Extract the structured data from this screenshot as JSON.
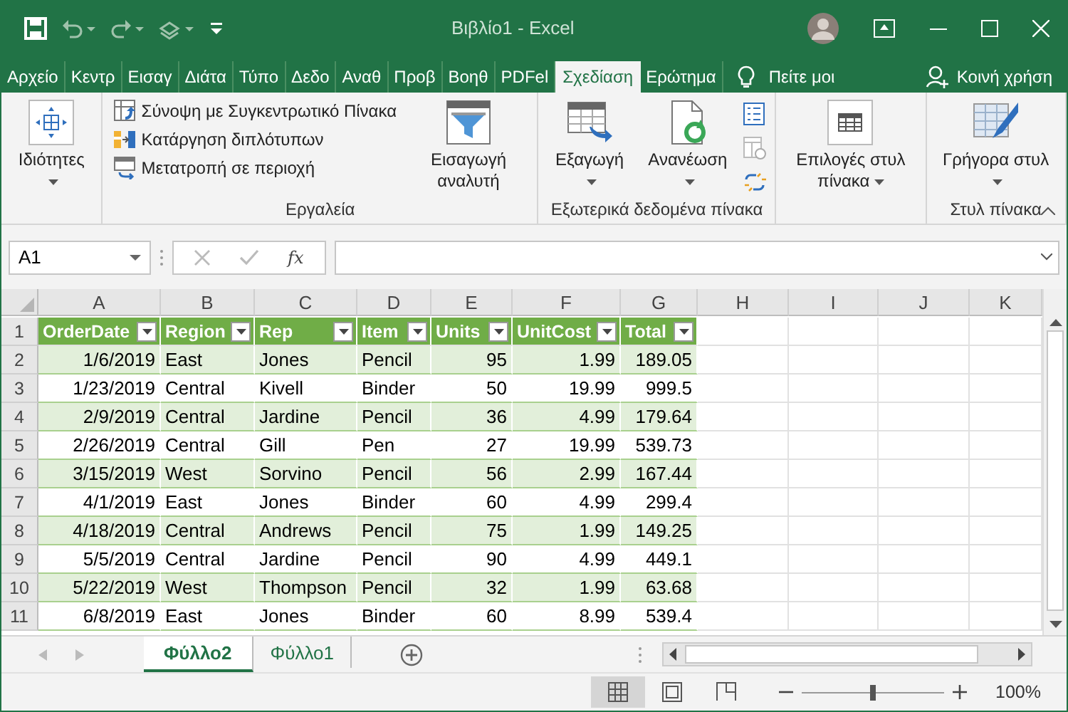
{
  "window": {
    "title": "Βιβλίο1 - Excel"
  },
  "ribbon_tabs": [
    {
      "label": "Αρχείο",
      "selected": false
    },
    {
      "label": "Κεντρ",
      "selected": false
    },
    {
      "label": "Εισαγ",
      "selected": false
    },
    {
      "label": "Διάτα",
      "selected": false
    },
    {
      "label": "Τύπο",
      "selected": false
    },
    {
      "label": "Δεδο",
      "selected": false
    },
    {
      "label": "Αναθ",
      "selected": false
    },
    {
      "label": "Προβ",
      "selected": false
    },
    {
      "label": "Βοηθ",
      "selected": false
    },
    {
      "label": "PDFel",
      "selected": false
    },
    {
      "label": "Σχεδίαση",
      "selected": true
    },
    {
      "label": "Ερώτημα",
      "selected": false
    }
  ],
  "tell_me": "Πείτε μοι",
  "share": "Κοινή χρήση",
  "ribbon_groups": [
    {
      "items": [
        {
          "kind": "large",
          "label": "Ιδιότητες",
          "dropdown": true
        }
      ]
    },
    {
      "label": "Εργαλεία",
      "items": [
        {
          "kind": "stack",
          "buttons": [
            {
              "label": "Σύνοψη με Συγκεντρωτικό Πίνακα"
            },
            {
              "label": "Κατάργηση διπλότυπων"
            },
            {
              "label": "Μετατροπή σε περιοχή"
            }
          ]
        },
        {
          "kind": "large",
          "label": "Εισαγωγή αναλυτή",
          "dropdown": false
        }
      ]
    },
    {
      "label": "Εξωτερικά δεδομένα πίνακα",
      "items": [
        {
          "kind": "large",
          "label": "Εξαγωγή",
          "dropdown": true
        },
        {
          "kind": "large",
          "label": "Ανανέωση",
          "dropdown": true
        },
        {
          "kind": "icons"
        }
      ]
    },
    {
      "items": [
        {
          "kind": "large",
          "label": "Επιλογές στυλ πίνακα",
          "dropdown": true
        }
      ]
    },
    {
      "label": "Στυλ πίνακα",
      "items": [
        {
          "kind": "large",
          "label": "Γρήγορα στυλ",
          "dropdown": true
        }
      ]
    }
  ],
  "formula_bar": {
    "name_box": "A1",
    "function_label": "fx"
  },
  "sheet": {
    "column_letters": [
      "A",
      "B",
      "C",
      "D",
      "E",
      "F",
      "G",
      "H",
      "I",
      "J",
      "K"
    ],
    "table": {
      "columns": [
        {
          "header": "OrderDate",
          "kind": "number"
        },
        {
          "header": "Region",
          "kind": "text"
        },
        {
          "header": "Rep",
          "kind": "text"
        },
        {
          "header": "Item",
          "kind": "text"
        },
        {
          "header": "Units",
          "kind": "number"
        },
        {
          "header": "UnitCost",
          "kind": "number"
        },
        {
          "header": "Total",
          "kind": "number"
        }
      ],
      "rows": [
        [
          "1/6/2019",
          "East",
          "Jones",
          "Pencil",
          "95",
          "1.99",
          "189.05"
        ],
        [
          "1/23/2019",
          "Central",
          "Kivell",
          "Binder",
          "50",
          "19.99",
          "999.5"
        ],
        [
          "2/9/2019",
          "Central",
          "Jardine",
          "Pencil",
          "36",
          "4.99",
          "179.64"
        ],
        [
          "2/26/2019",
          "Central",
          "Gill",
          "Pen",
          "27",
          "19.99",
          "539.73"
        ],
        [
          "3/15/2019",
          "West",
          "Sorvino",
          "Pencil",
          "56",
          "2.99",
          "167.44"
        ],
        [
          "4/1/2019",
          "East",
          "Jones",
          "Binder",
          "60",
          "4.99",
          "299.4"
        ],
        [
          "4/18/2019",
          "Central",
          "Andrews",
          "Pencil",
          "75",
          "1.99",
          "149.25"
        ],
        [
          "5/5/2019",
          "Central",
          "Jardine",
          "Pencil",
          "90",
          "4.99",
          "449.1"
        ],
        [
          "5/22/2019",
          "West",
          "Thompson",
          "Pencil",
          "32",
          "1.99",
          "63.68"
        ],
        [
          "6/8/2019",
          "East",
          "Jones",
          "Binder",
          "60",
          "8.99",
          "539.4"
        ]
      ]
    },
    "row_numbers": [
      "1",
      "2",
      "3",
      "4",
      "5",
      "6",
      "7",
      "8",
      "9",
      "10",
      "11"
    ]
  },
  "sheet_tabs": [
    {
      "label": "Φύλλο2",
      "selected": true
    },
    {
      "label": "Φύλλο1",
      "selected": false
    }
  ],
  "status_bar": {
    "zoom": {
      "level": 0.5,
      "reading": "100%"
    }
  }
}
